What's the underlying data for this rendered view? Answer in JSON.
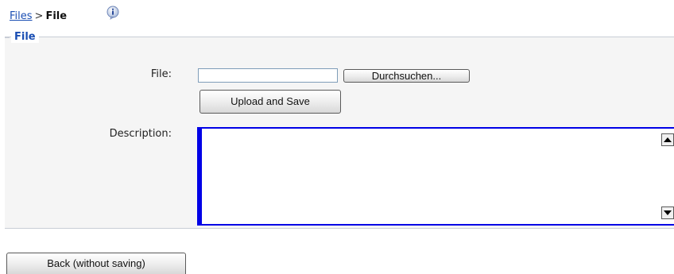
{
  "breadcrumb": {
    "root": "Files",
    "separator": ">",
    "current": "File"
  },
  "section": {
    "legend": "File"
  },
  "form": {
    "file_label": "File:",
    "file_value": "",
    "browse_label": "Durchsuchen...",
    "upload_label": "Upload and Save",
    "description_label": "Description:",
    "description_value": ""
  },
  "footer": {
    "back_label": "Back (without saving)"
  },
  "icons": {
    "info": "info-icon",
    "scroll_up": "arrow-up-icon",
    "scroll_down": "arrow-down-icon"
  },
  "colors": {
    "link": "#1a4eb3",
    "focus_border": "#0000e6",
    "panel_bg": "#f5f5f5"
  }
}
